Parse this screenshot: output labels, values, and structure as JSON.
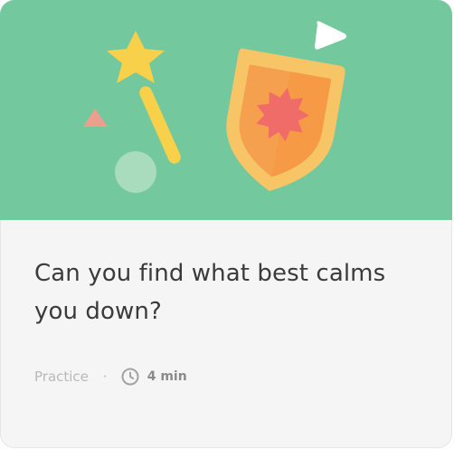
{
  "card": {
    "title": "Can you find what best calms you down?",
    "meta": {
      "kind": "Practice",
      "separator": "·",
      "duration": "4 min",
      "icon": "clock-icon"
    }
  },
  "illustration": {
    "icons": [
      "star-wand-icon",
      "shield-badge-icon",
      "triangle-shape-icon",
      "circle-shape-icon",
      "play-triangle-icon"
    ]
  },
  "colors": {
    "hero_background": "#74c89d",
    "card_background": "#f5f5f5",
    "star": "#f8d04a",
    "shield": "#f7c566",
    "shield_inner": "#f5a04e",
    "burst": "#ef6c68"
  }
}
